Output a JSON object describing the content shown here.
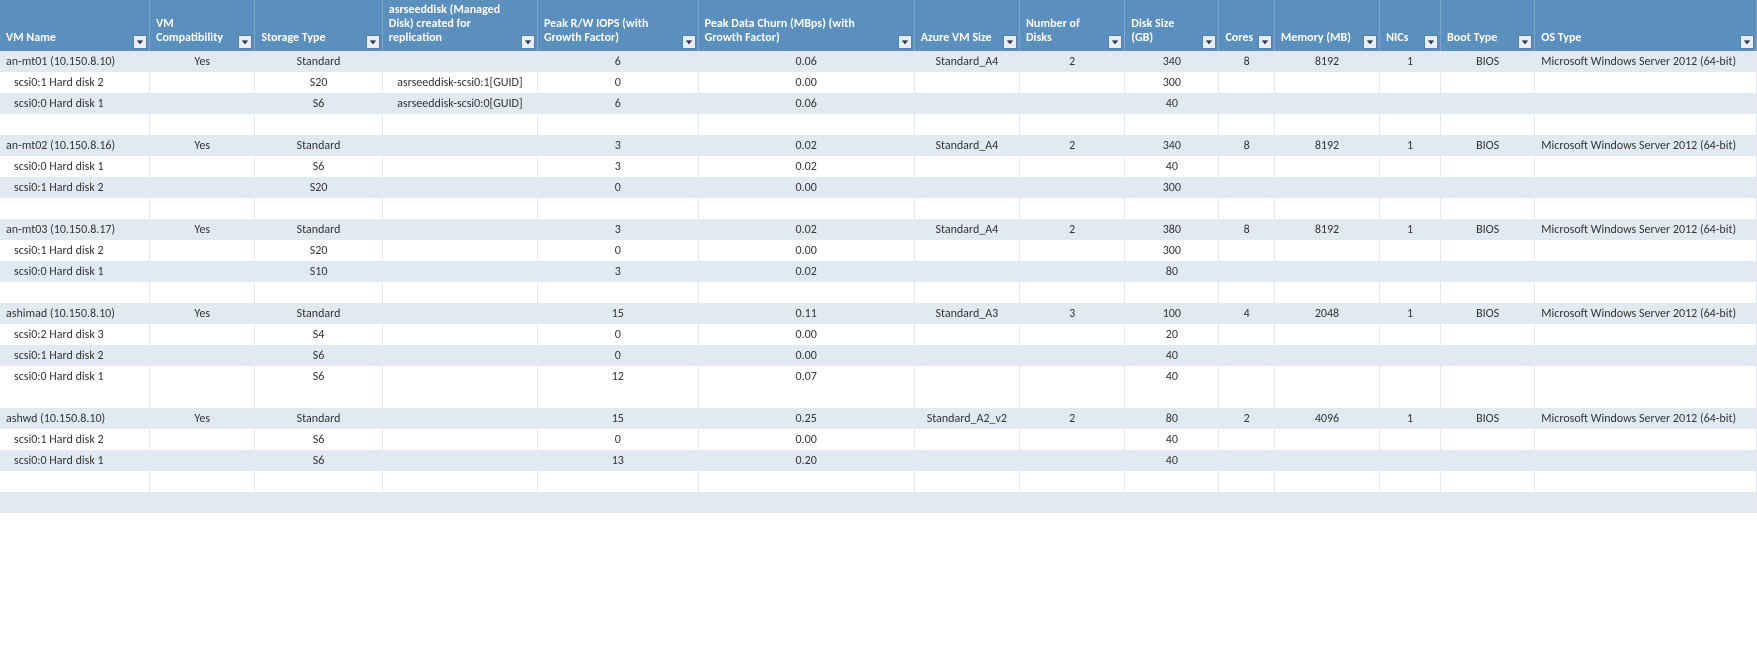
{
  "columns": [
    {
      "label": "VM Name",
      "align": "l"
    },
    {
      "label": "VM Compatibility",
      "align": "c"
    },
    {
      "label": "Storage Type",
      "align": "c"
    },
    {
      "label": "asrseeddisk (Managed Disk) created for replication",
      "align": "c"
    },
    {
      "label": "Peak R/W IOPS (with Growth Factor)",
      "align": "c"
    },
    {
      "label": "Peak Data Churn (MBps) (with Growth Factor)",
      "align": "c"
    },
    {
      "label": "Azure VM Size",
      "align": "c"
    },
    {
      "label": "Number of Disks",
      "align": "c"
    },
    {
      "label": "Disk Size (GB)",
      "align": "c"
    },
    {
      "label": "Cores",
      "align": "c"
    },
    {
      "label": "Memory (MB)",
      "align": "c"
    },
    {
      "label": "NICs",
      "align": "c"
    },
    {
      "label": "Boot Type",
      "align": "c"
    },
    {
      "label": "OS Type",
      "align": "l"
    }
  ],
  "rows": [
    {
      "stripe": "even",
      "cells": [
        "an-mt01 (10.150.8.10)",
        "Yes",
        "Standard",
        "",
        "6",
        "0.06",
        "Standard_A4",
        "2",
        "340",
        "8",
        "8192",
        "1",
        "BIOS",
        "Microsoft Windows Server 2012 (64-bit)"
      ]
    },
    {
      "stripe": "odd",
      "cells": [
        "  scsi0:1 Hard disk 2",
        "",
        "S20",
        "asrseeddisk-scsi0:1[GUID]",
        "0",
        "0.00",
        "",
        "",
        "300",
        "",
        "",
        "",
        "",
        ""
      ]
    },
    {
      "stripe": "even",
      "cells": [
        "  scsi0:0 Hard disk 1",
        "",
        "S6",
        "asrseeddisk-scsi0:0[GUID]",
        "6",
        "0.06",
        "",
        "",
        "40",
        "",
        "",
        "",
        "",
        ""
      ]
    },
    {
      "blank": true
    },
    {
      "stripe": "even",
      "cells": [
        "an-mt02 (10.150.8.16)",
        "Yes",
        "Standard",
        "",
        "3",
        "0.02",
        "Standard_A4",
        "2",
        "340",
        "8",
        "8192",
        "1",
        "BIOS",
        "Microsoft Windows Server 2012 (64-bit)"
      ]
    },
    {
      "stripe": "odd",
      "cells": [
        "  scsi0:0 Hard disk 1",
        "",
        "S6",
        "",
        "3",
        "0.02",
        "",
        "",
        "40",
        "",
        "",
        "",
        "",
        ""
      ]
    },
    {
      "stripe": "even",
      "cells": [
        "  scsi0:1 Hard disk 2",
        "",
        "S20",
        "",
        "0",
        "0.00",
        "",
        "",
        "300",
        "",
        "",
        "",
        "",
        ""
      ]
    },
    {
      "blank": true
    },
    {
      "stripe": "even",
      "cells": [
        "an-mt03 (10.150.8.17)",
        "Yes",
        "Standard",
        "",
        "3",
        "0.02",
        "Standard_A4",
        "2",
        "380",
        "8",
        "8192",
        "1",
        "BIOS",
        "Microsoft Windows Server 2012 (64-bit)"
      ]
    },
    {
      "stripe": "odd",
      "cells": [
        "  scsi0:1 Hard disk 2",
        "",
        "S20",
        "",
        "0",
        "0.00",
        "",
        "",
        "300",
        "",
        "",
        "",
        "",
        ""
      ]
    },
    {
      "stripe": "even",
      "cells": [
        "  scsi0:0 Hard disk 1",
        "",
        "S10",
        "",
        "3",
        "0.02",
        "",
        "",
        "80",
        "",
        "",
        "",
        "",
        ""
      ]
    },
    {
      "blank": true
    },
    {
      "stripe": "even",
      "cells": [
        "ashimad (10.150.8.10)",
        "Yes",
        "Standard",
        "",
        "15",
        "0.11",
        "Standard_A3",
        "3",
        "100",
        "4",
        "2048",
        "1",
        "BIOS",
        "Microsoft Windows Server 2012 (64-bit)"
      ]
    },
    {
      "stripe": "odd",
      "cells": [
        "  scsi0:2 Hard disk 3",
        "",
        "S4",
        "",
        "0",
        "0.00",
        "",
        "",
        "20",
        "",
        "",
        "",
        "",
        ""
      ]
    },
    {
      "stripe": "even",
      "cells": [
        "  scsi0:1 Hard disk 2",
        "",
        "S6",
        "",
        "0",
        "0.00",
        "",
        "",
        "40",
        "",
        "",
        "",
        "",
        ""
      ]
    },
    {
      "stripe": "odd",
      "cells": [
        "  scsi0:0 Hard disk 1",
        "",
        "S6",
        "",
        "12",
        "0.07",
        "",
        "",
        "40",
        "",
        "",
        "",
        "",
        ""
      ]
    },
    {
      "blank": true
    },
    {
      "stripe": "even",
      "cells": [
        "ashwd (10.150.8.10)",
        "Yes",
        "Standard",
        "",
        "15",
        "0.25",
        "Standard_A2_v2",
        "2",
        "80",
        "2",
        "4096",
        "1",
        "BIOS",
        "Microsoft Windows Server 2012 (64-bit)"
      ]
    },
    {
      "stripe": "odd",
      "cells": [
        "  scsi0:1 Hard disk 2",
        "",
        "S6",
        "",
        "0",
        "0.00",
        "",
        "",
        "40",
        "",
        "",
        "",
        "",
        ""
      ]
    },
    {
      "stripe": "even",
      "cells": [
        "  scsi0:0 Hard disk 1",
        "",
        "S6",
        "",
        "13",
        "0.20",
        "",
        "",
        "40",
        "",
        "",
        "",
        "",
        ""
      ]
    },
    {
      "blank": true
    },
    {
      "stripe": "even",
      "cells": [
        "",
        "",
        "",
        "",
        "",
        "",
        "",
        "",
        "",
        "",
        "",
        "",
        "",
        ""
      ]
    }
  ]
}
